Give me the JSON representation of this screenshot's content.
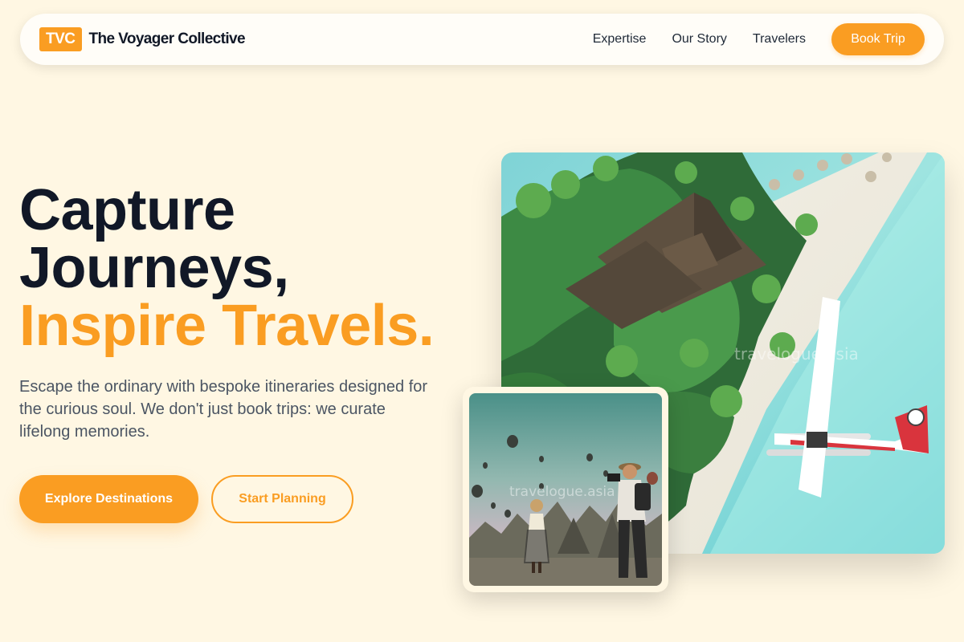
{
  "header": {
    "logo_badge": "TVC",
    "brand_name": "The Voyager Collective",
    "nav": [
      "Expertise",
      "Our Story",
      "Travelers"
    ],
    "cta_label": "Book Trip"
  },
  "hero": {
    "title_line1": "Capture",
    "title_line2": "Journeys,",
    "title_line3": "Inspire Travels.",
    "description": "Escape the ordinary with bespoke itineraries designed for the curious soul. We don't just book trips: we curate lifelong memories.",
    "primary_cta": "Explore Destinations",
    "secondary_cta": "Start Planning"
  },
  "images": {
    "main_watermark": "travelogue.asia",
    "inset_watermark": "travelogue.asia"
  },
  "colors": {
    "accent": "#fa9d22",
    "background": "#fff7e3",
    "heading": "#111827",
    "body_text": "#4b5563"
  }
}
